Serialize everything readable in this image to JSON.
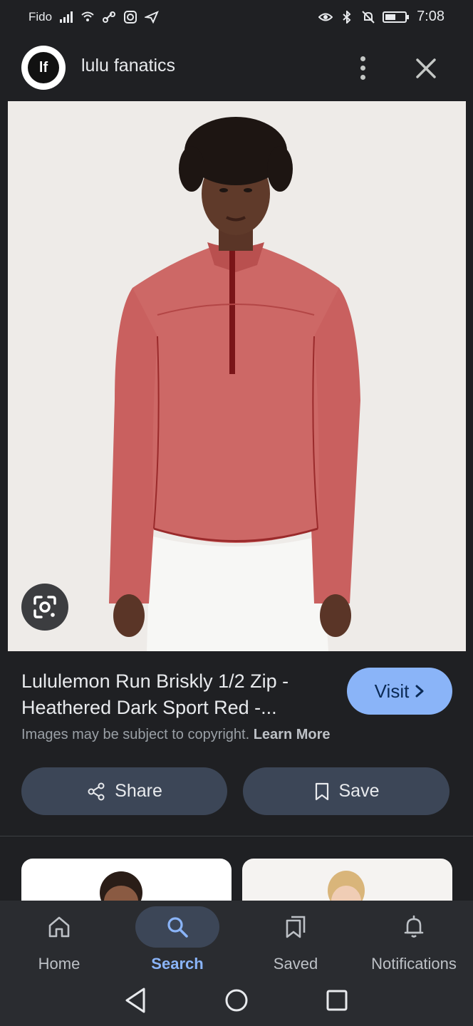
{
  "status_bar": {
    "carrier": "Fido",
    "time": "7:08"
  },
  "header": {
    "logo_text": "lf",
    "site_name": "lulu fanatics"
  },
  "result": {
    "title_line1": "Lululemon Run Briskly 1/2 Zip -",
    "title_line2": "Heathered Dark Sport Red -...",
    "visit_label": "Visit",
    "copyright_text": "Images may be subject to copyright.",
    "learn_more": "Learn More"
  },
  "actions": {
    "share_label": "Share",
    "save_label": "Save"
  },
  "bottom_nav": {
    "items": [
      {
        "label": "Home",
        "icon": "home-icon",
        "active": false
      },
      {
        "label": "Search",
        "icon": "search-icon",
        "active": true
      },
      {
        "label": "Saved",
        "icon": "saved-icon",
        "active": false
      },
      {
        "label": "Notifications",
        "icon": "bell-icon",
        "active": false
      }
    ]
  },
  "colors": {
    "accent": "#8ab4f8",
    "background": "#1f2023",
    "pill": "#3c4657",
    "shirt": "#c9605f"
  }
}
